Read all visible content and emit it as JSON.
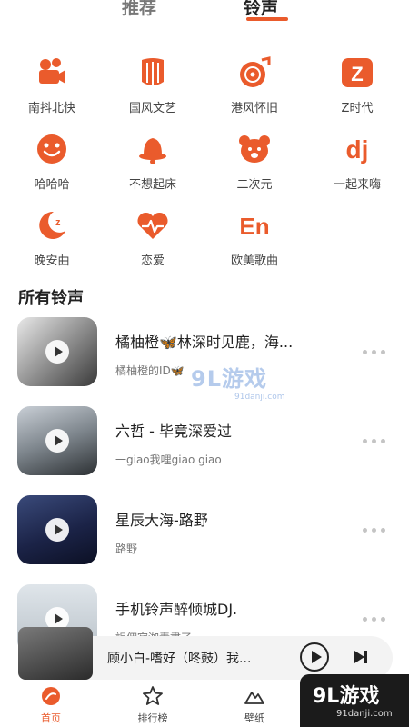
{
  "tabs": [
    {
      "label": "推荐",
      "active": false
    },
    {
      "label": "铃声",
      "active": true
    }
  ],
  "accent_color": "#ea5b2c",
  "categories": [
    {
      "label": "南抖北快",
      "icon": "camera-icon"
    },
    {
      "label": "国风文艺",
      "icon": "harp-icon"
    },
    {
      "label": "港风怀旧",
      "icon": "vinyl-icon"
    },
    {
      "label": "Z时代",
      "icon": "z-letter-icon",
      "glyph": "Z"
    },
    {
      "label": "哈哈哈",
      "icon": "smile-icon"
    },
    {
      "label": "不想起床",
      "icon": "bell-icon"
    },
    {
      "label": "二次元",
      "icon": "bear-icon"
    },
    {
      "label": "一起来嗨",
      "icon": "dj-icon",
      "glyph": "dj"
    },
    {
      "label": "晚安曲",
      "icon": "moon-icon",
      "glyph": "z"
    },
    {
      "label": "恋爱",
      "icon": "heartbeat-icon"
    },
    {
      "label": "欧美歌曲",
      "icon": "en-icon",
      "glyph": "En"
    }
  ],
  "section_title": "所有铃声",
  "songs": [
    {
      "title": "橘柚橙🦋林深时见鹿，海...",
      "subtitle": "橘柚橙的ID🦋"
    },
    {
      "title": "六哲 - 毕竟深爱过",
      "subtitle": "一giao我哩giao giao"
    },
    {
      "title": "星辰大海-路野",
      "subtitle": "路野"
    },
    {
      "title": "手机铃声醉倾城DJ.",
      "subtitle": "誤佣寂洳責盡了"
    }
  ],
  "player": {
    "title": "顾小白-嗜好（咚鼓）我..."
  },
  "bottom_nav": [
    {
      "label": "首页",
      "icon": "home-disc-icon",
      "active": true
    },
    {
      "label": "排行榜",
      "icon": "star-icon",
      "active": false
    },
    {
      "label": "壁纸",
      "icon": "mountain-icon",
      "active": false
    }
  ],
  "watermark": {
    "logo": "9L游戏",
    "domain": "91danji.com"
  }
}
